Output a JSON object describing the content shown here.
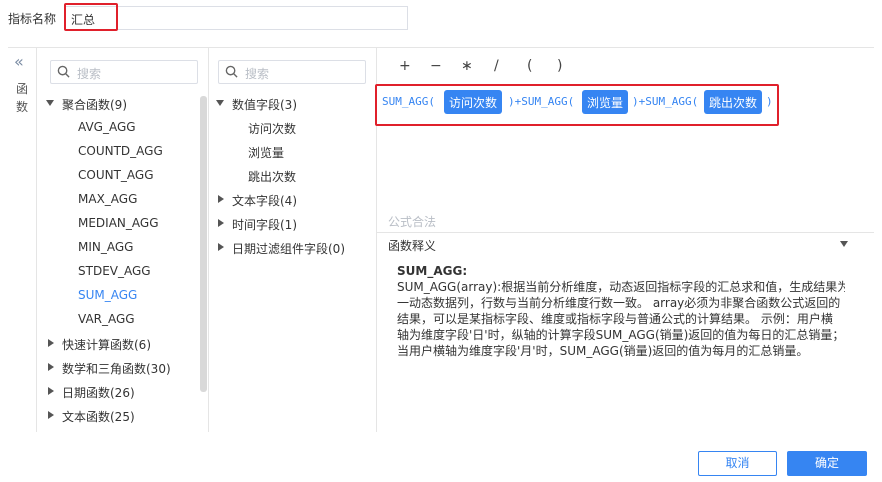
{
  "name_field": {
    "label": "指标名称",
    "value": "汇总"
  },
  "side": {
    "collapse_text": "函数"
  },
  "func_panel": {
    "search_placeholder": "搜索",
    "groups": [
      {
        "label": "聚合函数(9)",
        "expanded": true,
        "items": [
          "AVG_AGG",
          "COUNTD_AGG",
          "COUNT_AGG",
          "MAX_AGG",
          "MEDIAN_AGG",
          "MIN_AGG",
          "STDEV_AGG",
          "SUM_AGG",
          "VAR_AGG"
        ],
        "selected": "SUM_AGG"
      },
      {
        "label": "快速计算函数(6)",
        "expanded": false
      },
      {
        "label": "数学和三角函数(30)",
        "expanded": false
      },
      {
        "label": "日期函数(26)",
        "expanded": false
      },
      {
        "label": "文本函数(25)",
        "expanded": false
      }
    ]
  },
  "field_panel": {
    "search_placeholder": "搜索",
    "groups": [
      {
        "label": "数值字段(3)",
        "expanded": true,
        "items": [
          "访问次数",
          "浏览量",
          "跳出次数"
        ]
      },
      {
        "label": "文本字段(4)",
        "expanded": false
      },
      {
        "label": "时间字段(1)",
        "expanded": false
      },
      {
        "label": "日期过滤组件字段(0)",
        "expanded": false
      }
    ]
  },
  "operators": [
    "+",
    "−",
    "∗",
    "/",
    "(",
    ")"
  ],
  "formula": {
    "parts": [
      "SUM_AGG(",
      "访问次数",
      ")+SUM_AGG(",
      "浏览量",
      ")+SUM_AGG(",
      "跳出次数",
      ")"
    ]
  },
  "status_text": "公式合法",
  "explain": {
    "title": "函数释义",
    "func_name": "SUM_AGG:",
    "lines": [
      "SUM_AGG(array):根据当前分析维度，动态返回指标字段的汇总求和值，生成结果为",
      "一动态数据列，行数与当前分析维度行数一致。 array必须为非聚合函数公式返回的",
      "结果，可以是某指标字段、维度或指标字段与普通公式的计算结果。 示例：用户横",
      "轴为维度字段'日'时，纵轴的计算字段SUM_AGG(销量)返回的值为每日的汇总销量；",
      "当用户横轴为维度字段'月'时，SUM_AGG(销量)返回的值为每月的汇总销量。"
    ]
  },
  "buttons": {
    "cancel": "取消",
    "ok": "确定"
  },
  "colors": {
    "accent": "#3685f2",
    "highlight": "#e0202b"
  }
}
